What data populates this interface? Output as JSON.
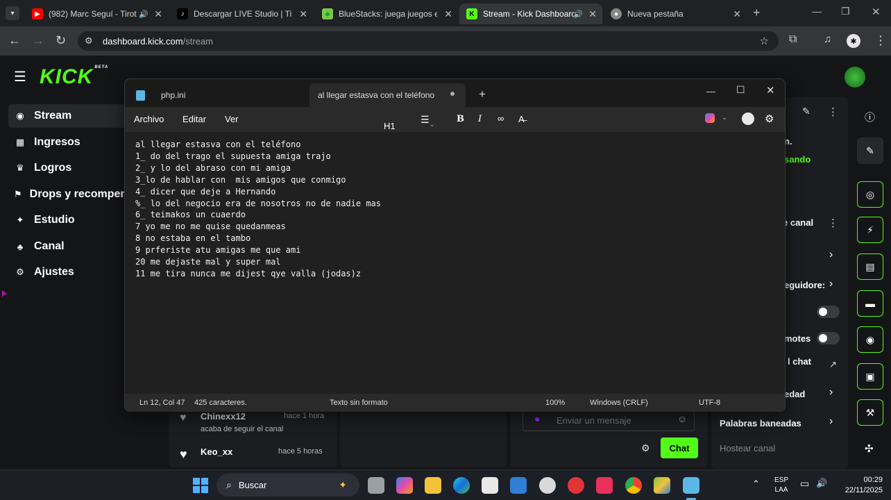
{
  "browser": {
    "tabs": [
      {
        "title": "(982) Marc Seguí - Tirot",
        "icon": "youtube-icon",
        "color": "#ff0000"
      },
      {
        "title": "Descargar LIVE Studio | TikTo",
        "icon": "tiktok-icon",
        "color": "#000000"
      },
      {
        "title": "BlueStacks: juega juegos en",
        "icon": "bluestacks-icon",
        "color": "#7cc64a"
      },
      {
        "title": "Stream - Kick Dashboard",
        "icon": "kick-icon",
        "color": "#53fc18",
        "active": true
      },
      {
        "title": "Nueva pestaña",
        "icon": "chrome-icon",
        "color": "#aaaaaa"
      }
    ],
    "url_domain": "dashboard.kick.com",
    "url_path": "/stream"
  },
  "kick": {
    "logo": "KICK",
    "beta": "BETA",
    "sidebar": [
      {
        "label": "Stream",
        "icon": "stream-icon",
        "glyph": "◉",
        "active": true
      },
      {
        "label": "Ingresos",
        "icon": "revenue-icon",
        "glyph": "▦"
      },
      {
        "label": "Logros",
        "icon": "trophy-icon",
        "glyph": "♛"
      },
      {
        "label": "Drops y recompensas",
        "icon": "drops-icon",
        "glyph": "⚑"
      },
      {
        "label": "Estudio",
        "icon": "studio-icon",
        "glyph": "✦"
      },
      {
        "label": "Canal",
        "icon": "channel-icon",
        "glyph": "♣"
      },
      {
        "label": "Ajustes",
        "icon": "settings-icon",
        "glyph": "⚙"
      }
    ],
    "activity": [
      {
        "user": "Chinexx12",
        "time": "hace 1 hora",
        "text": "acaba de seguir el canal"
      },
      {
        "user": "Keo_xx",
        "time": "hace 5 horas",
        "text": ""
      }
    ],
    "chat_placeholder": "Enviar un mensaje",
    "chat_button": "Chat",
    "right_partial": {
      "n": "n.",
      "sando": "sando",
      "canal": "e canal",
      "seguidores": "eguidore:",
      "motes": "motes",
      "chat": "l chat",
      "edad": "edad",
      "banned": "Palabras baneadas",
      "host": "Hostear canal"
    }
  },
  "notepad": {
    "tabs": [
      "php.ini",
      "al llegar estasva con el teléfono"
    ],
    "menu": [
      "Archivo",
      "Editar",
      "Ver"
    ],
    "heading": "H1",
    "lines": [
      "al llegar estasva con el teléfono",
      "1_ do del trago el supuesta amiga trajo",
      "2_ y lo del abraso con mi amiga",
      "3_lo de hablar con  mis amigos que conmigo",
      "4_ dicer que deje a Hernando",
      "%_ lo del negocio era de nosotros no de nadie mas",
      "6_ teimakos un cuaerdo",
      "7 yo me no me quise quedanmeas",
      "8 no estaba en el tambo",
      "9 prferiste atu amigas me que ami",
      "20 me dejaste mal y super mal",
      "11 me tira nunca me dijest qye valla (jodas)z"
    ],
    "status": {
      "position": "Ln 12, Col 47",
      "chars": "425 caracteres.",
      "format": "Texto sin formato",
      "zoom": "100%",
      "eol": "Windows (CRLF)",
      "encoding": "UTF-8"
    }
  },
  "taskbar": {
    "search": "Buscar",
    "lang": "ESP",
    "region": "LAA",
    "time": "00:29",
    "date": "22/11/2025"
  }
}
